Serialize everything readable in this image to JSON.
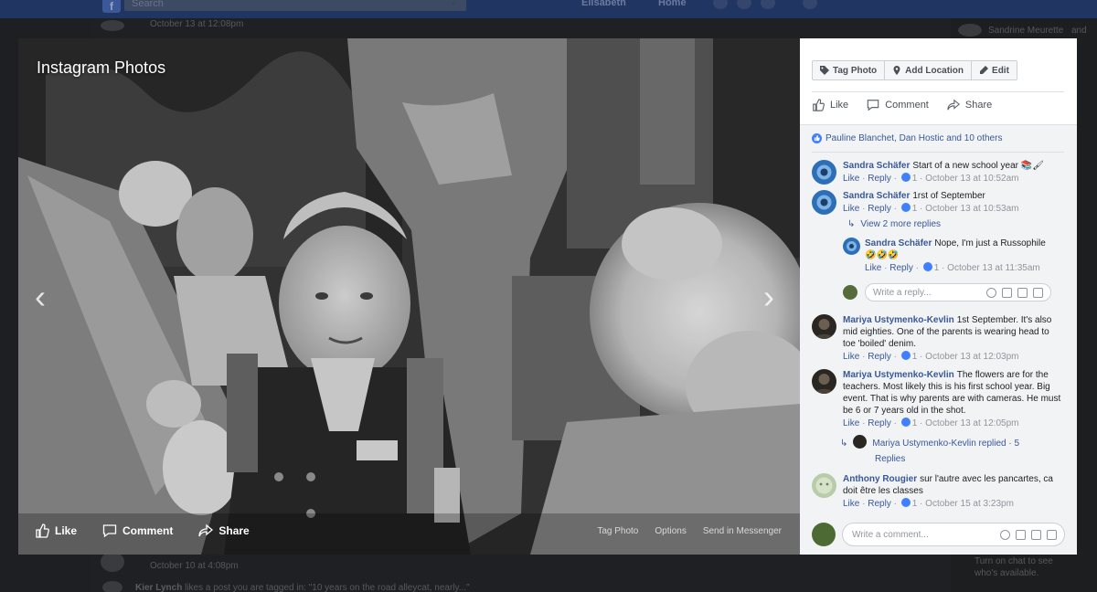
{
  "background": {
    "search_placeholder": "Search",
    "user_name": "Elisabeth",
    "home_label": "Home",
    "post_time_1": "October 13 at 12:08pm",
    "post_time_2": "October 10 at 4:08pm",
    "notification_name": "Kier Lynch",
    "notification_text": "likes a post you are tagged in: \"10 years on the road alleycat, nearly...\"",
    "right_name": "Sandrine Meurette",
    "right_name_suffix": "and",
    "right_bottom": "Turn on chat to see who's available."
  },
  "photo": {
    "album_title": "Instagram Photos",
    "actions": {
      "like": "Like",
      "comment": "Comment",
      "share": "Share"
    },
    "links": {
      "tag": "Tag Photo",
      "options": "Options",
      "messenger": "Send in Messenger"
    },
    "prev_arrow": "‹",
    "next_arrow": "›"
  },
  "panel": {
    "toolbar": {
      "tag_photo": "Tag Photo",
      "add_location": "Add Location",
      "edit": "Edit"
    },
    "actions": {
      "like": "Like",
      "comment": "Comment",
      "share": "Share"
    },
    "likers": "Pauline Blanchet, Dan Hostic and 10 others",
    "comments": [
      {
        "name": "Sandra Schäfer",
        "text": "Start of a new school year 📚🖌",
        "like": "Like",
        "reply": "Reply",
        "count": "1",
        "time": "October 13 at 10:52am"
      },
      {
        "name": "Sandra Schäfer",
        "text": "1rst of September",
        "like": "Like",
        "reply": "Reply",
        "count": "1",
        "time": "October 13 at 10:53am"
      },
      {
        "name": "Mariya Ustymenko-Kevlin",
        "text": "1st September. It's also mid eighties. One of the parents is wearing head to toe 'boiled' denim.",
        "like": "Like",
        "reply": "Reply",
        "count": "1",
        "time": "October 13 at 12:03pm"
      },
      {
        "name": "Mariya Ustymenko-Kevlin",
        "text": "The flowers are for the teachers. Most likely this is his first school year. Big event. That is why parents are with cameras. He must be 6 or 7 years old in the shot.",
        "like": "Like",
        "reply": "Reply",
        "count": "1",
        "time": "October 13 at 12:05pm"
      },
      {
        "name": "Anthony Rougier",
        "text": "sur l'autre avec les pancartes, ca doit être les classes",
        "like": "Like",
        "reply": "Reply",
        "count": "1",
        "time": "October 15 at 3:23pm"
      }
    ],
    "view_more": "View 2 more replies",
    "reply": {
      "name": "Sandra Schäfer",
      "text": "Nope, I'm just a Russophile 🤣🤣🤣",
      "like": "Like",
      "reply": "Reply",
      "count": "1",
      "time": "October 13 at 11:35am"
    },
    "write_reply_placeholder": "Write a reply...",
    "replied": {
      "name": "Mariya Ustymenko-Kevlin",
      "action": "replied",
      "dot": "·",
      "count_text": "5",
      "replies_label": "Replies"
    },
    "write_comment_placeholder": "Write a comment..."
  },
  "colors": {
    "link": "#385898",
    "accent": "#4080ff",
    "topbar": "#203561"
  }
}
